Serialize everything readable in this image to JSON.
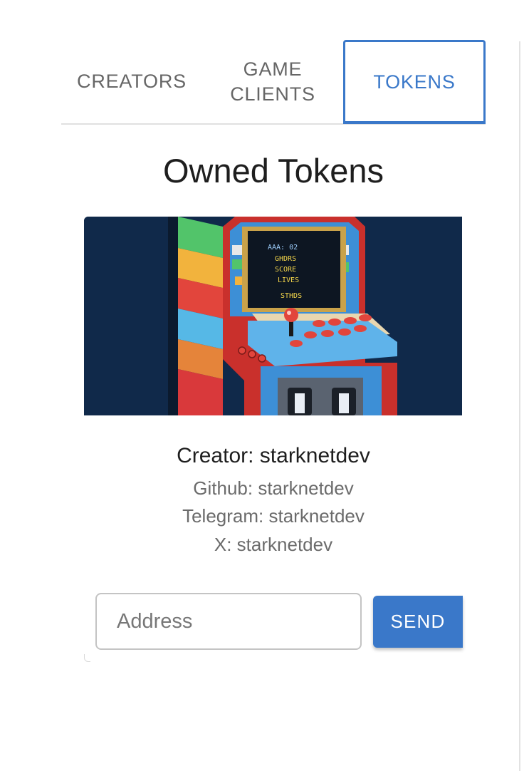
{
  "tabs": [
    {
      "label": "CREATORS"
    },
    {
      "label": "GAME CLIENTS"
    },
    {
      "label": "TOKENS"
    }
  ],
  "active_tab": "TOKENS",
  "page_title": "Owned Tokens",
  "token": {
    "image_icon": "arcade-cabinet-pixel-art",
    "screen_text": [
      "AAA: 02",
      "GHDRS",
      "SCORE",
      "LIVES",
      "STHDS"
    ],
    "creator": "Creator: starknetdev",
    "github": "Github: starknetdev",
    "telegram": "Telegram: starknetdev",
    "x": "X: starknetdev"
  },
  "form": {
    "address_placeholder": "Address",
    "address_value": "",
    "send_label": "SEND"
  },
  "colors": {
    "accent": "#3a78c9",
    "image_background": "#10294a"
  }
}
